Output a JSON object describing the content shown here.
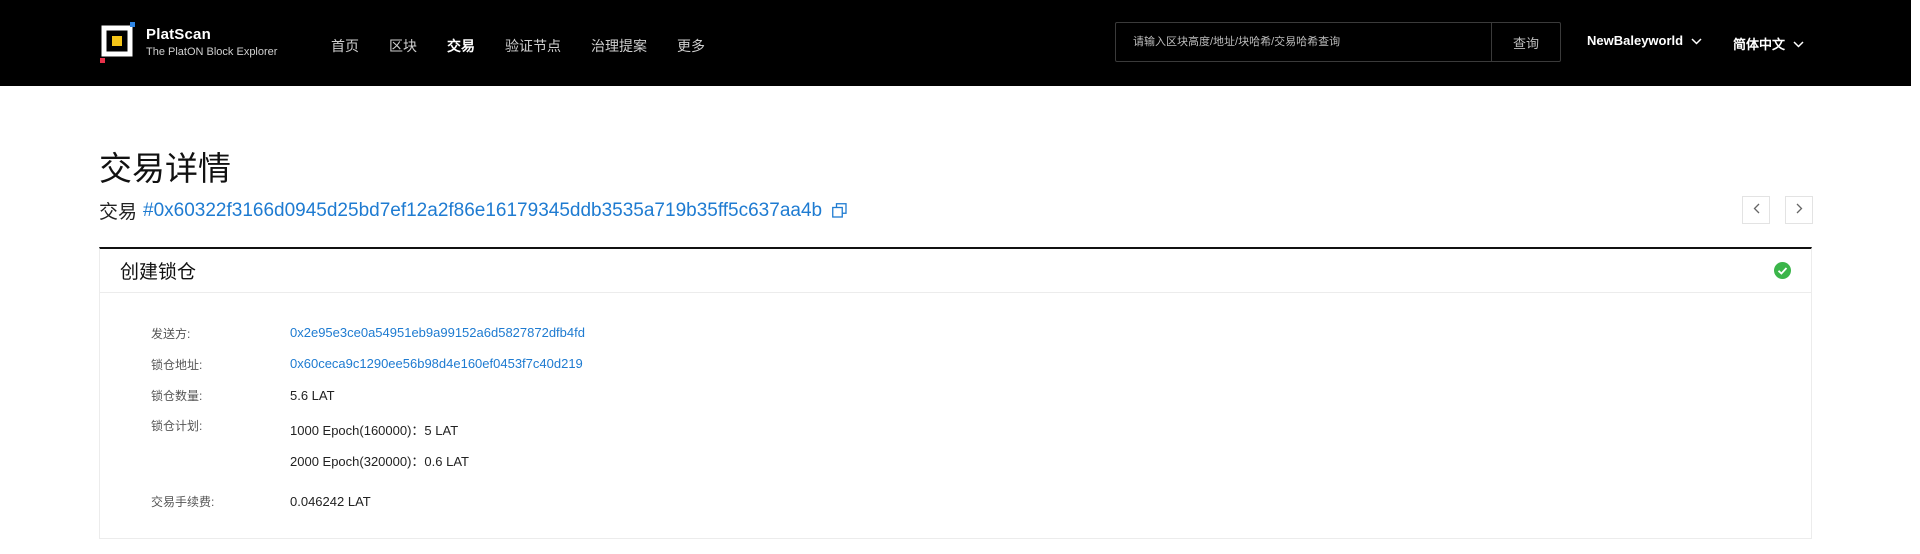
{
  "header": {
    "brand_name": "PlatScan",
    "brand_sub": "The PlatON Block Explorer",
    "nav": [
      "首页",
      "区块",
      "交易",
      "验证节点",
      "治理提案",
      "更多"
    ],
    "active_nav": "交易",
    "search": {
      "placeholder": "请输入区块高度/地址/块哈希/交易哈希查询",
      "button": "查询"
    },
    "network": "NewBaleyworld",
    "language": "简体中文"
  },
  "page": {
    "title": "交易详情",
    "tx_label": "交易",
    "tx_hash": "#0x60322f3166d0945d25bd7ef12a2f86e16179345ddb3535a719b35ff5c637aa4b"
  },
  "card": {
    "title": "创建锁仓",
    "status_color": "#3bb54a",
    "fields": {
      "sender_label": "发送方:",
      "sender_value": "0x2e95e3ce0a54951eb9a99152a6d5827872dfb4fd",
      "lock_address_label": "锁仓地址:",
      "lock_address_value": "0x60ceca9c1290ee56b98d4e160ef0453f7c40d219",
      "lock_amount_label": "锁仓数量:",
      "lock_amount_value": "5.6 LAT",
      "lock_plan_label": "锁仓计划:",
      "lock_plan": [
        "1000 Epoch(160000)：5 LAT",
        "2000 Epoch(320000)：0.6 LAT"
      ],
      "fee_label": "交易手续费:",
      "fee_value": "0.046242 LAT"
    }
  },
  "colors": {
    "topbar": "#000000",
    "link": "#1e7bd1",
    "logo_accent_yellow": "#f5c518",
    "logo_accent_blue": "#2f86e6",
    "logo_accent_red": "#e8314a"
  }
}
